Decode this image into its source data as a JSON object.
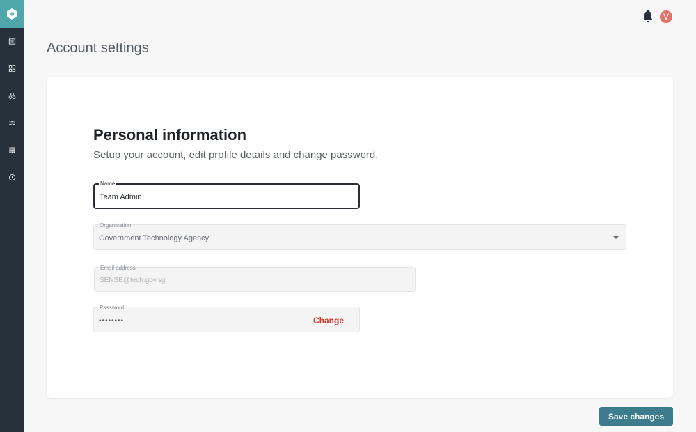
{
  "colors": {
    "sidebar_bg": "#26313b",
    "logo_bg": "#4fa6ab",
    "primary_button": "#3d7c8c",
    "change_link": "#d9362b",
    "avatar_bg": "#e0736b"
  },
  "sidebar": {
    "logo_icon": "sense-logo-icon",
    "items": [
      {
        "icon": "newspaper-icon"
      },
      {
        "icon": "dashboard-grid-icon"
      },
      {
        "icon": "cluster-icon"
      },
      {
        "icon": "filters-icon"
      },
      {
        "icon": "apps-grid-icon"
      },
      {
        "icon": "clock-icon"
      }
    ]
  },
  "topbar": {
    "bell_icon": "bell-icon",
    "avatar_initial": "V"
  },
  "page": {
    "title": "Account settings"
  },
  "personal_info": {
    "title": "Personal information",
    "subtitle": "Setup your account, edit profile details and change password.",
    "name": {
      "label": "Name",
      "value": "Team Admin"
    },
    "organisation": {
      "label": "Organisation",
      "value": "Government Technology Agency"
    },
    "email": {
      "label": "Email address",
      "value": "SENSE@tech.gov.sg"
    },
    "password": {
      "label": "Password",
      "value": "••••••••",
      "change_label": "Change"
    }
  },
  "actions": {
    "save_label": "Save changes"
  }
}
